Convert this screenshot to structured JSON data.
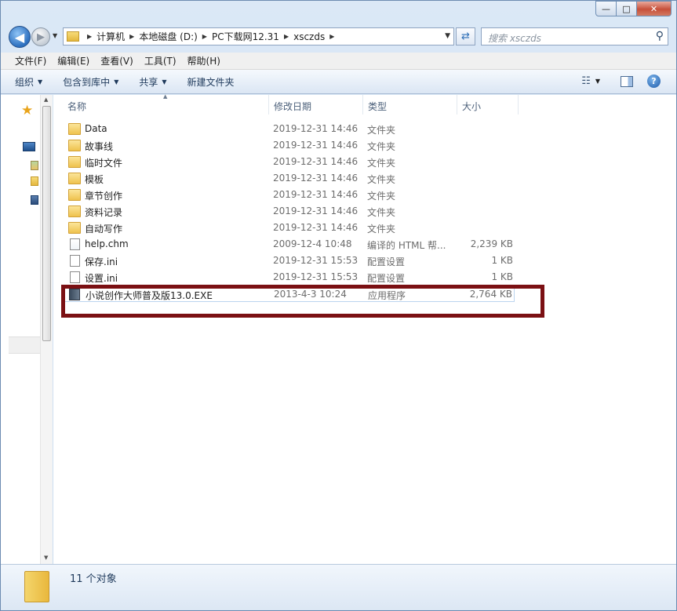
{
  "caption": {
    "minimize": "—",
    "maximize": "□",
    "close": "✕"
  },
  "nav": {
    "back_glyph": "◀",
    "forward_glyph": "▶",
    "breadcrumbs": [
      "计算机",
      "本地磁盘 (D:)",
      "PC下载网12.31",
      "xsczds"
    ],
    "search_placeholder": "搜索 xsczds"
  },
  "menu": [
    "文件(F)",
    "编辑(E)",
    "查看(V)",
    "工具(T)",
    "帮助(H)"
  ],
  "toolbar": {
    "organize": "组织",
    "include_in_library": "包含到库中",
    "share": "共享",
    "new_folder": "新建文件夹"
  },
  "columns": {
    "name": "名称",
    "modified": "修改日期",
    "type": "类型",
    "size": "大小"
  },
  "files": [
    {
      "name": "Data",
      "date": "2019-12-31 14:46",
      "type": "文件夹",
      "size": "",
      "icon": "folder-icon"
    },
    {
      "name": "故事线",
      "date": "2019-12-31 14:46",
      "type": "文件夹",
      "size": "",
      "icon": "folder-icon"
    },
    {
      "name": "临时文件",
      "date": "2019-12-31 14:46",
      "type": "文件夹",
      "size": "",
      "icon": "folder-icon"
    },
    {
      "name": "模板",
      "date": "2019-12-31 14:46",
      "type": "文件夹",
      "size": "",
      "icon": "folder-icon"
    },
    {
      "name": "章节创作",
      "date": "2019-12-31 14:46",
      "type": "文件夹",
      "size": "",
      "icon": "folder-icon"
    },
    {
      "name": "资料记录",
      "date": "2019-12-31 14:46",
      "type": "文件夹",
      "size": "",
      "icon": "folder-icon"
    },
    {
      "name": "自动写作",
      "date": "2019-12-31 14:46",
      "type": "文件夹",
      "size": "",
      "icon": "folder-icon"
    },
    {
      "name": "help.chm",
      "date": "2009-12-4 10:48",
      "type": "编译的 HTML 帮...",
      "size": "2,239 KB",
      "icon": "chm-file-icon"
    },
    {
      "name": "保存.ini",
      "date": "2019-12-31 15:53",
      "type": "配置设置",
      "size": "1 KB",
      "icon": "ini-file-icon"
    },
    {
      "name": "设置.ini",
      "date": "2019-12-31 15:53",
      "type": "配置设置",
      "size": "1 KB",
      "icon": "ini-file-icon"
    },
    {
      "name": "小说创作大师普及版13.0.EXE",
      "date": "2013-4-3 10:24",
      "type": "应用程序",
      "size": "2,764 KB",
      "icon": "exe-file-icon"
    }
  ],
  "status": {
    "count_text": "11 个对象"
  },
  "colors": {
    "highlight_box": "#7b1013",
    "selection_border": "#bcd5ef",
    "folder": "#efc24e"
  }
}
